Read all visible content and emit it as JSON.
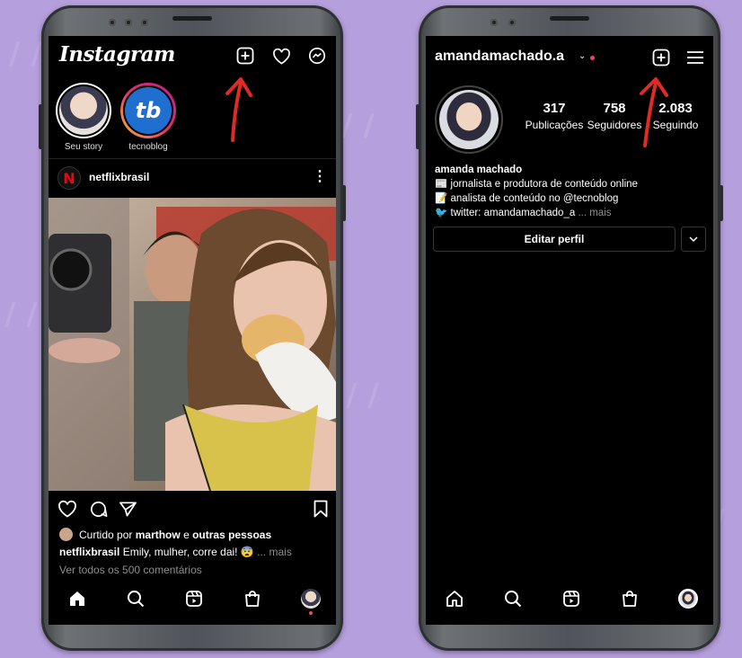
{
  "colors": {
    "background": "#b59fdc",
    "arrow": "#e02a24",
    "netflix": "#e50914",
    "notification_dot": "#ed4956",
    "story_ring_start": "#f7b73a",
    "story_ring_end": "#c21e8d"
  },
  "feed": {
    "header": {
      "logo": "Instagram",
      "icons": [
        "new-post-icon",
        "heart-icon",
        "messenger-icon"
      ]
    },
    "stories": [
      {
        "label": "Seu story"
      },
      {
        "label": "tecnoblog",
        "avatar_text": "tb"
      }
    ],
    "post": {
      "username": "netflixbrasil",
      "avatar_letter": "N",
      "more": "⋮",
      "liked_prefix": "Curtido por ",
      "liked_user": "marthow",
      "liked_and": " e ",
      "liked_others": "outras pessoas",
      "caption_user": "netflixbrasil",
      "caption_text": " Emily, mulher, corre dai! 😨",
      "caption_more": "... mais",
      "comments": "Ver todos os 500 comentários"
    },
    "bottom_nav": [
      "home-icon",
      "search-icon",
      "reels-icon",
      "shop-icon",
      "profile-avatar"
    ]
  },
  "profile": {
    "username": "amandamachado.a",
    "chevron": "⌄",
    "stats": [
      {
        "num": "317",
        "label": "Publicações"
      },
      {
        "num": "758",
        "label": "Seguidores"
      },
      {
        "num": "2.083",
        "label": "Seguindo"
      }
    ],
    "bio": {
      "name": "amanda machado",
      "line1": "📰 jornalista e produtora de conteúdo online",
      "line2": "📝 analista de conteúdo no @tecnoblog",
      "line3": "🐦 twitter: amandamachado_a",
      "more": "... mais"
    },
    "edit_button": "Editar perfil"
  }
}
